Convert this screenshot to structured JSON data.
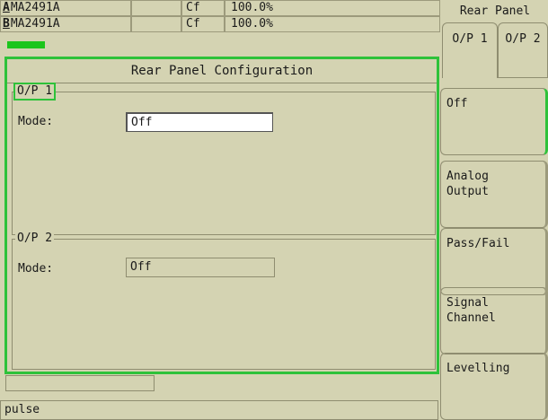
{
  "sensors": [
    {
      "letter": "A",
      "model": "MA2491A",
      "cal": "Cf",
      "value": "100.0%"
    },
    {
      "letter": "B",
      "model": "MA2491A",
      "cal": "Cf",
      "value": "100.0%"
    }
  ],
  "dialog": {
    "title": "Rear Panel Configuration",
    "op1": {
      "label": "O/P 1",
      "mode_label": "Mode:",
      "mode_value": "Off"
    },
    "op2": {
      "label": "O/P 2",
      "mode_label": "Mode:",
      "mode_value": "Off"
    }
  },
  "status": {
    "text": "pulse"
  },
  "side_panel": {
    "title": "Rear Panel",
    "tabs": [
      {
        "label": "O/P 1",
        "active": true
      },
      {
        "label": "O/P 2",
        "active": false
      }
    ],
    "softkeys": [
      {
        "label": "Off",
        "active": true
      },
      {
        "label": "Analog\nOutput",
        "active": false
      },
      {
        "label": "Pass/Fail",
        "active": false
      },
      {
        "label": "Signal\nChannel",
        "active": false
      },
      {
        "label": "Levelling",
        "active": false
      }
    ]
  },
  "colors": {
    "background": "#d4d3b2",
    "accent": "#2ec23a",
    "selected_field": "#ffffff"
  }
}
